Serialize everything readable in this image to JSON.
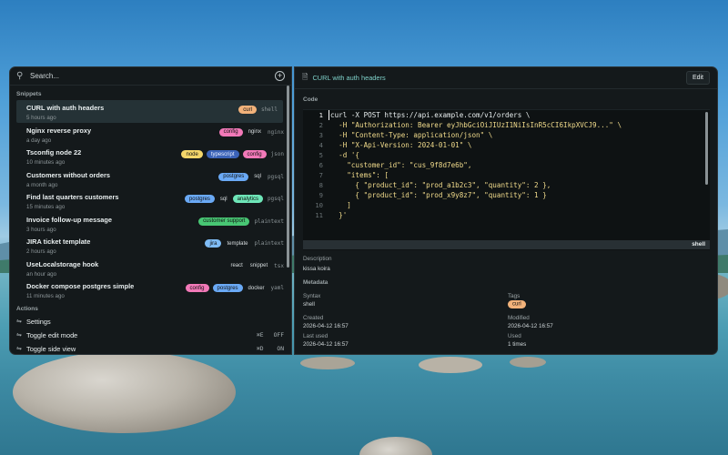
{
  "colors": {
    "accent": "#7fd1c9",
    "tag_curl": "#f2b27a",
    "tag_config": "#f279b8",
    "tag_nginx": "#1f2a2d",
    "tag_node": "#f4d66a",
    "tag_typescript": "#3b63b8",
    "tag_postgres": "#6aa9f5",
    "tag_analytics": "#6ee6b8",
    "tag_customer_support": "#48c774",
    "tag_jira": "#7fbcf5"
  },
  "search": {
    "placeholder": "Search..."
  },
  "sidebar": {
    "snippets_label": "Snippets",
    "items": [
      {
        "title": "CURL with auth headers",
        "sub": "5 hours ago",
        "tags": [
          "curl"
        ],
        "lang": "shell"
      },
      {
        "title": "Nginx reverse proxy",
        "sub": "a day ago",
        "tags": [
          "config",
          "nginx"
        ],
        "lang": "nginx"
      },
      {
        "title": "Tsconfig node 22",
        "sub": "10 minutes ago",
        "tags": [
          "node",
          "typescript",
          "config"
        ],
        "lang": "json"
      },
      {
        "title": "Customers without orders",
        "sub": "a month ago",
        "tags": [
          "postgres",
          "sql"
        ],
        "lang": "pgsql"
      },
      {
        "title": "Find last quarters customers",
        "sub": "15 minutes ago",
        "tags": [
          "postgres",
          "sql",
          "analytics"
        ],
        "lang": "pgsql"
      },
      {
        "title": "Invoice follow-up message",
        "sub": "3 hours ago",
        "tags": [
          "customer support"
        ],
        "lang": "plaintext"
      },
      {
        "title": "JIRA ticket template",
        "sub": "2 hours ago",
        "tags": [
          "jira",
          "template"
        ],
        "lang": "plaintext"
      },
      {
        "title": "UseLocalstorage hook",
        "sub": "an hour ago",
        "tags": [
          "react",
          "snippet"
        ],
        "lang": "tsx"
      },
      {
        "title": "Docker compose postgres simple",
        "sub": "11 minutes ago",
        "tags": [
          "config",
          "postgres",
          "docker"
        ],
        "lang": "yaml"
      }
    ],
    "actions_label": "Actions",
    "actions": [
      {
        "label": "Settings",
        "kbd1": "",
        "kbd2": ""
      },
      {
        "label": "Toggle edit mode",
        "kbd1": "⌘E",
        "kbd2": "OFF"
      },
      {
        "label": "Toggle side view",
        "kbd1": "⌘D",
        "kbd2": "ON"
      }
    ]
  },
  "detail": {
    "title": "CURL with auth headers",
    "edit_label": "Edit",
    "code_label": "Code",
    "line_numbers": [
      "1",
      "2",
      "3",
      "4",
      "5",
      "6",
      "7",
      "8",
      "9",
      "10",
      "11"
    ],
    "code_lines": [
      "curl -X POST https://api.example.com/v1/orders \\",
      "  -H \"Authorization: Bearer eyJhbGciOiJIUzI1NiIsInR5cCI6IkpXVCJ9...\" \\",
      "  -H \"Content-Type: application/json\" \\",
      "  -H \"X-Api-Version: 2024-01-01\" \\",
      "  -d '{",
      "    \"customer_id\": \"cus_9f8d7e6b\",",
      "    \"items\": [",
      "      { \"product_id\": \"prod_a1b2c3\", \"quantity\": 2 },",
      "      { \"product_id\": \"prod_x9y8z7\", \"quantity\": 1 }",
      "    ]",
      "  }'"
    ],
    "code_footer": "shell",
    "description_label": "Description",
    "description": "kissa koira",
    "metadata_label": "Metadata",
    "syntax_label": "Syntax",
    "syntax": "shell",
    "tags_label": "Tags",
    "tag": "curl",
    "created_label": "Created",
    "created": "2026-04-12 16:57",
    "modified_label": "Modified",
    "modified": "2026-04-12 16:57",
    "last_used_label": "Last used",
    "last_used": "2026-04-12 16:57",
    "used_label": "Used",
    "used": "1 times"
  }
}
